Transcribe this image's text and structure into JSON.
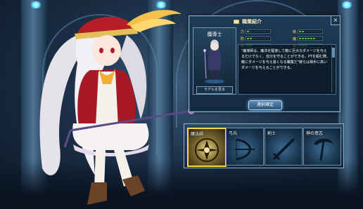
{
  "panel": {
    "title": "職業紹介",
    "close": "×",
    "class_name": "魔導士",
    "portrait_button": "モデルを見る",
    "stats": [
      {
        "label": "力",
        "value": 1
      },
      {
        "label": "敏",
        "value": 2
      },
      {
        "label": "防",
        "value": 2
      },
      {
        "label": "魔",
        "value": 6
      },
      {
        "label": "体",
        "value": 2
      },
      {
        "label": "会",
        "value": 3
      }
    ],
    "stat_scale": 8,
    "description": "\"魔導師は、魔法を駆使して敵に巨大なダメージを与えるだけでなく、自分を守ることができる。PTを組む際、敵にダメージを与え易くなる職業だ\"彼らは相手に高いダメージを与えることができる。",
    "select_button": "選択確定"
  },
  "classes": [
    {
      "label": "魔法師",
      "icon": "magic-sigil-icon",
      "active": true
    },
    {
      "label": "弓兵",
      "icon": "bow-icon",
      "active": false
    },
    {
      "label": "剣士",
      "icon": "sword-icon",
      "active": false
    },
    {
      "label": "神の意志",
      "icon": "scythe-icon",
      "active": false
    }
  ],
  "colors": {
    "panel_border": "#8fb2cf",
    "stat_label": "#ffd84a",
    "stat_fill": "#56c23a",
    "active_slot": "#ffd84a",
    "select_button": "#5b8ab4"
  }
}
